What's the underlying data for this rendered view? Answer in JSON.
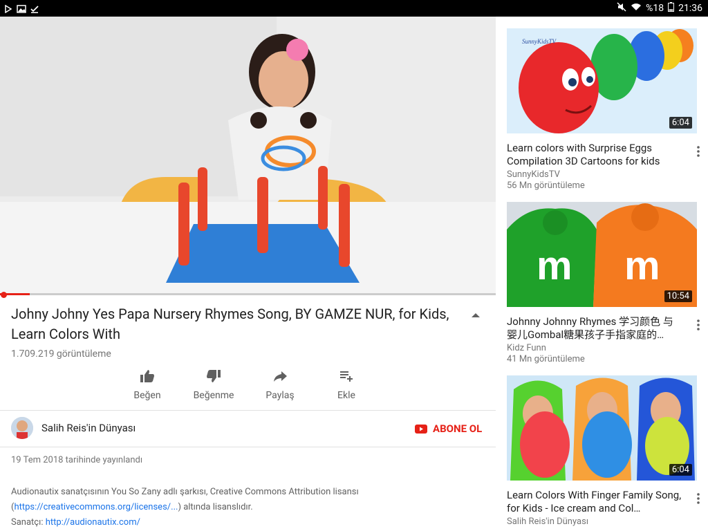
{
  "status_bar": {
    "battery": "%18",
    "time": "21:36"
  },
  "video": {
    "title": "Johny Johny Yes Papa Nursery Rhymes Song, BY GAMZE NUR, for Kids, Learn Colors With",
    "views": "1.709.219 görüntüleme",
    "progress_fraction": 0.06
  },
  "actions": [
    {
      "label": "Beğen",
      "icon": "thumb-up-icon"
    },
    {
      "label": "Beğenme",
      "icon": "thumb-down-icon"
    },
    {
      "label": "Paylaş",
      "icon": "share-icon"
    },
    {
      "label": "Ekle",
      "icon": "playlist-add-icon"
    }
  ],
  "channel": {
    "name": "Salih Reis'in Dünyası",
    "subscribe_label": "ABONE OL"
  },
  "published": "19 Tem 2018 tarihinde yayınlandı",
  "description": {
    "line1": "Audionautix sanatçısının You So Zany adlı şarkısı, Creative Commons Attribution lisansı",
    "paren_open": "(",
    "license_link": "https://creativecommons.org/licenses/...",
    "paren_close": ") altında lisanslıdır.",
    "artist_label": "Sanatçı: ",
    "artist_link": "http://audionautix.com/"
  },
  "related": [
    {
      "title": "Learn colors with Surprise Eggs Compilation 3D Cartoons for kids",
      "channel": "SunnyKidsTV",
      "views": "56 Mn görüntüleme",
      "duration": "6:04",
      "thumb_logo": "SunnyKidsTV"
    },
    {
      "title": "Johnny Johnny Rhymes 学习颜色 与婴儿Gombal糖果孩子手指家庭的…",
      "channel": "Kidz Funn",
      "views": "41 Mn görüntüleme",
      "duration": "10:54",
      "thumb_letter": "m"
    },
    {
      "title": "Learn Colors With Finger Family Song, for Kids - Ice cream and Col…",
      "channel": "Salih Reis'in Dünyası",
      "views": "",
      "duration": "6:04"
    }
  ],
  "colors": {
    "accent_red": "#e62117",
    "link_blue": "#1a73e8"
  }
}
